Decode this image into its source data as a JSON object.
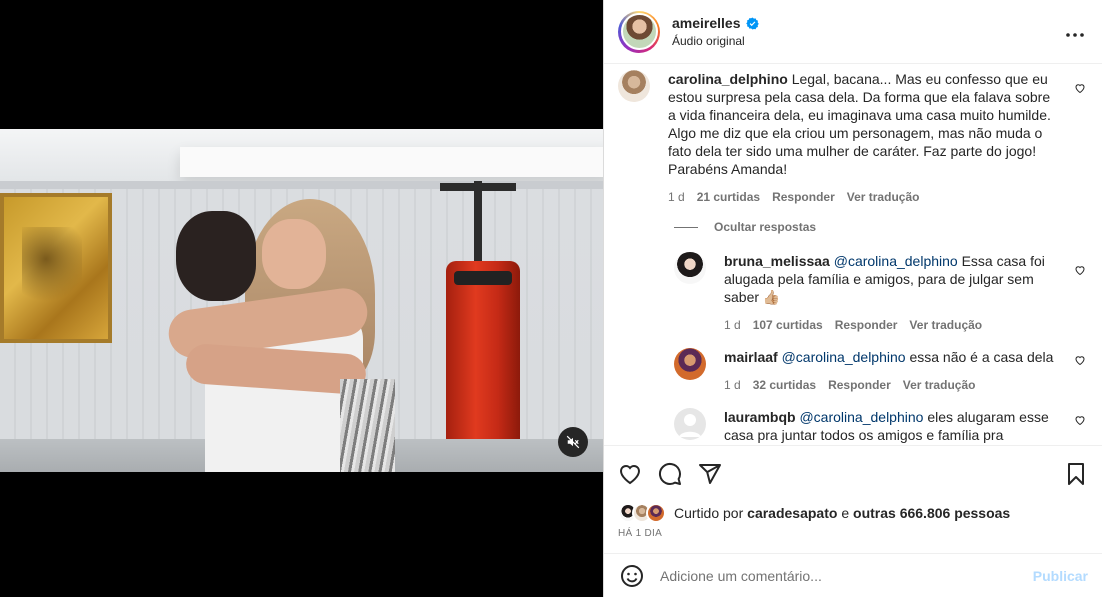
{
  "header": {
    "username": "ameirelles",
    "subtitle": "Áudio original"
  },
  "comments": [
    {
      "username": "carolina_delphino",
      "text": "Legal, bacana... Mas eu confesso que eu estou surpresa pela casa dela. Da forma que ela falava sobre a vida financeira dela, eu imaginava uma casa muito humilde. Algo me diz que ela criou um personagem, mas não muda o fato dela ter sido uma mulher de caráter. Faz parte do jogo! Parabéns Amanda!",
      "time": "1 d",
      "likes": "21 curtidas",
      "reply_label": "Responder",
      "translate_label": "Ver tradução"
    }
  ],
  "replies_toggle": "Ocultar respostas",
  "replies": [
    {
      "username": "bruna_melissaa",
      "mention": "@carolina_delphino",
      "text": "Essa casa foi alugada pela família e amigos, para de julgar sem saber 👍🏼",
      "time": "1 d",
      "likes": "107 curtidas",
      "reply_label": "Responder",
      "translate_label": "Ver tradução"
    },
    {
      "username": "mairlaaf",
      "mention": "@carolina_delphino",
      "text": "essa não é a casa dela",
      "time": "1 d",
      "likes": "32 curtidas",
      "reply_label": "Responder",
      "translate_label": "Ver tradução"
    },
    {
      "username": "laurambqb",
      "mention": "@carolina_delphino",
      "text": "eles alugaram esse casa pra juntar todos os amigos e família pra",
      "time": "",
      "likes": "",
      "reply_label": "",
      "translate_label": ""
    }
  ],
  "likes": {
    "prefix": "Curtido por",
    "user": "caradesapato",
    "connector": "e",
    "others": "outras 666.806 pessoas"
  },
  "post_date": "HÁ 1 DIA",
  "composer": {
    "placeholder": "Adicione um comentário...",
    "publish_label": "Publicar"
  },
  "colors": {
    "verified": "#0095f6",
    "mention": "#00376b",
    "publish_disabled": "#b3dbff"
  }
}
